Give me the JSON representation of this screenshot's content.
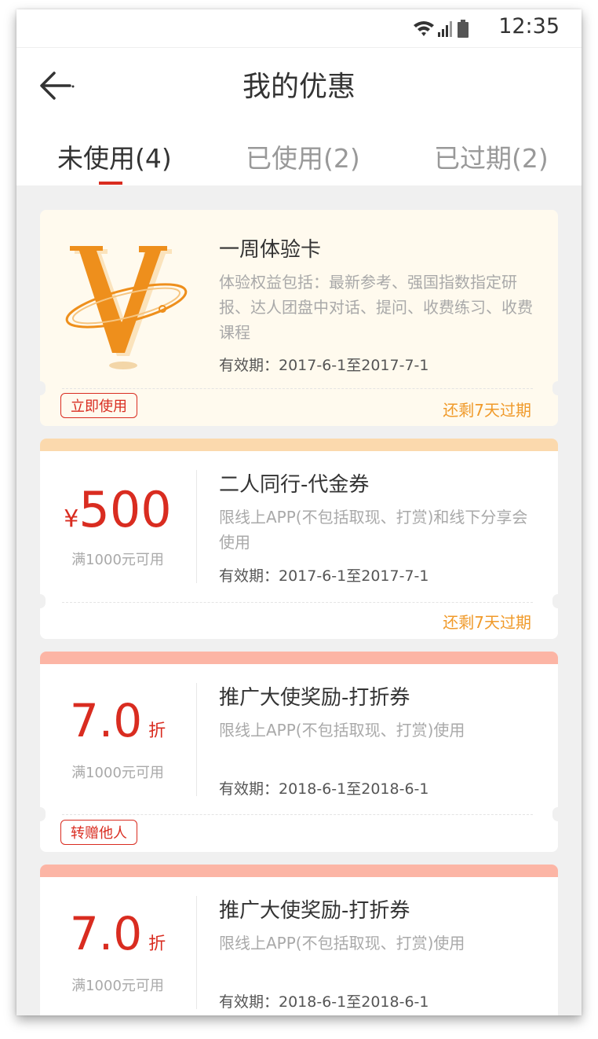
{
  "status": {
    "time": "12:35"
  },
  "header": {
    "title": "我的优惠"
  },
  "tabs": [
    {
      "label": "未使用(4)"
    },
    {
      "label": "已使用(2)"
    },
    {
      "label": "已过期(2)"
    }
  ],
  "cards": [
    {
      "title": "一周体验卡",
      "desc": "体验权益包括：最新参考、强国指数指定研报、达人团盘中对话、提问、收费练习、收费课程",
      "valid": "有效期：2017-6-1至2017-7-1",
      "remaining": "还剩7天过期",
      "action": "立即使用"
    },
    {
      "currency": "¥",
      "amount": "500",
      "condition": "满1000元可用",
      "title": "二人同行-代金券",
      "desc": "限线上APP(不包括取现、打赏)和线下分享会使用",
      "valid": "有效期：2017-6-1至2017-7-1",
      "remaining": "还剩7天过期"
    },
    {
      "amount": "7.0",
      "unit": "折",
      "condition": "满1000元可用",
      "title": "推广大使奖励-打折券",
      "desc": "限线上APP(不包括取现、打赏)使用",
      "valid": "有效期：2018-6-1至2018-6-1",
      "action": "转赠他人"
    },
    {
      "amount": "7.0",
      "unit": "折",
      "condition": "满1000元可用",
      "title": "推广大使奖励-打折券",
      "desc": "限线上APP(不包括取现、打赏)使用",
      "valid": "有效期：2018-6-1至2018-6-1"
    }
  ],
  "colors": {
    "accent": "#d92c20",
    "orange": "#f09a2a",
    "vip_card_bg": "#fffaee",
    "strip_voucher": "#fbd9ad",
    "strip_discount": "#fcb5a5"
  }
}
